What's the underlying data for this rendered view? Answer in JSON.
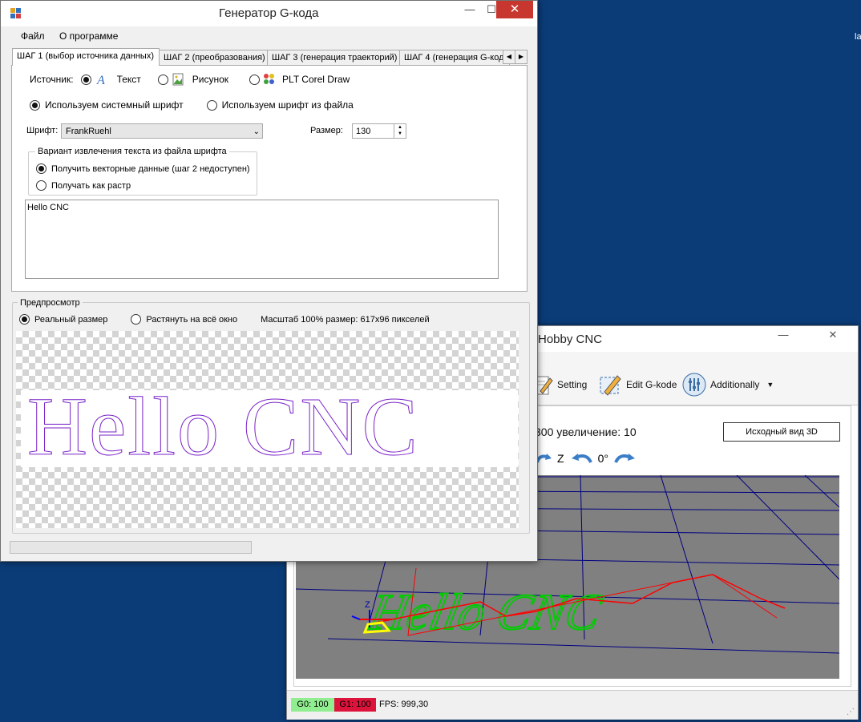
{
  "desktop": {
    "edge_text": "la"
  },
  "front_window": {
    "title": "Генератор G-кода",
    "controls": {
      "minimize": "—",
      "maximize": "☐",
      "close": "✕"
    },
    "menu": {
      "file": "Файл",
      "about": "О программе"
    },
    "tabs": [
      {
        "label": "ШАГ 1 (выбор источника данных)",
        "active": true
      },
      {
        "label": "ШАГ 2 (преобразования)",
        "active": false
      },
      {
        "label": "ШАГ 3 (генерация траекторий)",
        "active": false
      },
      {
        "label": "ШАГ 4 (генерация G-кода",
        "active": false
      }
    ],
    "step1": {
      "source_label": "Источник:",
      "source_options": [
        {
          "label": "Текст",
          "checked": true,
          "icon": "font-icon"
        },
        {
          "label": "Рисунок",
          "checked": false,
          "icon": "image-icon"
        },
        {
          "label": "PLT Corel Draw",
          "checked": false,
          "icon": "corel-icon"
        }
      ],
      "font_source": [
        {
          "label": "Используем системный шрифт",
          "checked": true
        },
        {
          "label": "Используем шрифт из файла",
          "checked": false
        }
      ],
      "font_label": "Шрифт:",
      "font_value": "FrankRuehl",
      "size_label": "Размер:",
      "size_value": "130",
      "extract_group_title": "Вариант извлечения текста из файла шрифта",
      "extract_options": [
        {
          "label": "Получить векторные данные (шаг 2 недоступен)",
          "checked": true
        },
        {
          "label": "Получать как растр",
          "checked": false
        }
      ],
      "text_value": "Hello CNC"
    },
    "preview": {
      "title": "Предпросмотр",
      "options": [
        {
          "label": "Реальный размер",
          "checked": true
        },
        {
          "label": "Растянуть на всё окно",
          "checked": false
        }
      ],
      "scale_text": "Масштаб 100% размер: 617x96 пикселей",
      "rendered_text": "Hello CNC"
    },
    "progress": 0
  },
  "back_window": {
    "title": "Hobby CNC",
    "controls": {
      "minimize": "—",
      "close": "✕"
    },
    "toolbar": {
      "setting": "Setting",
      "edit_gcode": "Edit G-kode",
      "additionally": "Additionally"
    },
    "zoom_info": "300 увеличение: 10",
    "view3d_button": "Исходный вид 3D",
    "rotation": {
      "axis": "Z",
      "angle": "0°"
    },
    "viewport_text": "Hello CNC",
    "status": {
      "g0": "G0: 100",
      "g1": "G1: 100",
      "fps": "FPS: 999,30"
    }
  },
  "colors": {
    "desktop": "#0b3c78",
    "close_red": "#c7372f",
    "g0_green": "#90ee90",
    "g1_red": "#dc143c",
    "preview_outline": "#7a22c8",
    "path_green": "#00cc00",
    "path_red": "#ff0000",
    "grid_blue": "#000080"
  }
}
